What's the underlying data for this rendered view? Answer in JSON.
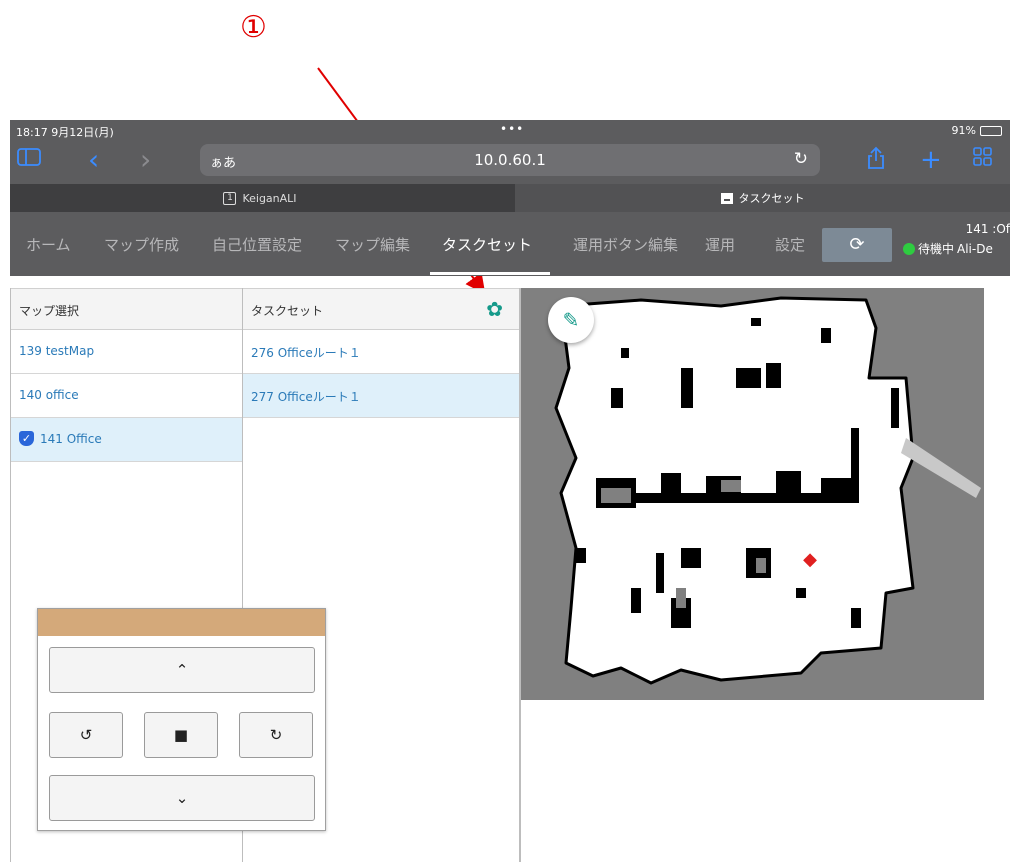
{
  "annotation": {
    "number": "①"
  },
  "status_bar": {
    "time": "18:17  9月12日(月)",
    "dots": "•••",
    "battery": "91%"
  },
  "toolbar": {
    "sidebar_icon": "sidebar-icon",
    "back_icon": "‹",
    "forward_icon": "›",
    "url_aa": "ぁあ",
    "url": "10.0.60.1",
    "reload_icon": "↻",
    "share_icon": "share-icon",
    "new_tab_icon": "+",
    "tabs_icon": "grid-icon",
    "accent": "#3b8cff"
  },
  "browser_tabs": [
    {
      "num": "1",
      "label": "KeiganALI"
    },
    {
      "label": "タスクセット"
    }
  ],
  "nav": {
    "items": [
      "ホーム",
      "マップ作成",
      "自己位置設定",
      "マップ編集",
      "タスクセット",
      "運用ボタン編集",
      "運用",
      "設定"
    ],
    "active": "タスクセット",
    "sync_icon": "sync-icon",
    "status_line1": "141 :Of",
    "status_text": "待機中",
    "device": "Ali-De",
    "status_color": "#2ecc40"
  },
  "map_panel": {
    "header": "マップ選択",
    "items": [
      {
        "label": "139 testMap",
        "selected": false
      },
      {
        "label": "140 office",
        "selected": false
      },
      {
        "label": "141 Office",
        "selected": true
      }
    ]
  },
  "task_panel": {
    "header": "タスクセット",
    "gear_icon": "gear-icon",
    "items": [
      {
        "label": "276 Officeルート１",
        "selected": false
      },
      {
        "label": "277 Officeルート１",
        "selected": true
      }
    ]
  },
  "map_view": {
    "edit_icon": "pencil-icon",
    "robot_icon": "robot-marker-icon"
  },
  "controller": {
    "header_color": "#d4a97a",
    "forward": "⌃",
    "rotate_left": "↺",
    "stop": "■",
    "rotate_right": "↻",
    "backward": "⌄"
  }
}
